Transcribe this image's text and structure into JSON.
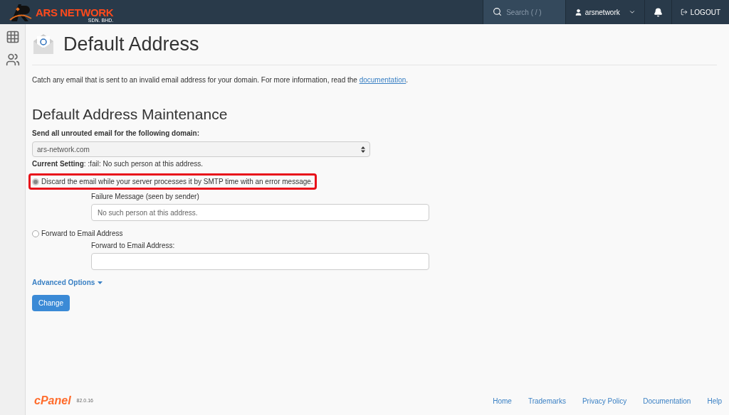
{
  "header": {
    "logo": {
      "name": "ARS NETWORK",
      "suffix": "SDN. BHD."
    },
    "search": {
      "placeholder": "Search ( / )"
    },
    "user": "arsnetwork",
    "logout": "LOGOUT"
  },
  "page": {
    "title": "Default Address",
    "description": {
      "text": "Catch any email that is sent to an invalid email address for your domain. For more information, read the ",
      "link": "documentation",
      "end": "."
    }
  },
  "section": {
    "title": "Default Address Maintenance",
    "domain_label": "Send all unrouted email for the following domain:",
    "domain_value": "ars-network.com",
    "current_label": "Current Setting",
    "current_value": ": :fail: No such person at this address.",
    "options": [
      {
        "label": "Discard the email while your server processes it by SMTP time with an error message.",
        "selected": true,
        "highlighted": true,
        "field_label": "Failure Message (seen by sender)",
        "placeholder": "No such person at this address."
      },
      {
        "label": "Forward to Email Address",
        "selected": false,
        "highlighted": false,
        "field_label": "Forward to Email Address:"
      }
    ],
    "advanced": "Advanced Options",
    "button": "Change"
  },
  "footer": {
    "logo": "cPanel",
    "version": "82.0.16",
    "links": [
      "Home",
      "Trademarks",
      "Privacy Policy",
      "Documentation",
      "Help"
    ]
  }
}
